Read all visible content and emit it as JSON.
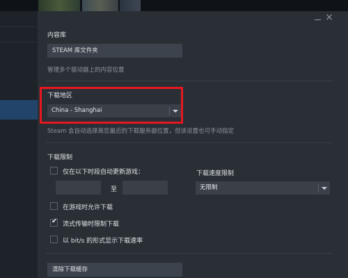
{
  "window": {
    "minimize_icon": "minimize-icon",
    "close_glyph": "×"
  },
  "library": {
    "heading": "内容库",
    "button_label": "STEAM 库文件夹",
    "description": "管理多个驱动器上的内容位置"
  },
  "download_region": {
    "heading": "下载地区",
    "selected": "China - Shanghai",
    "description": "Steam 会自动选择离您最近的下载服务器位置，但该设置也可手动指定",
    "highlight_color": "#e8171f"
  },
  "download_limits": {
    "heading": "下载限制",
    "schedule_label": "仅在以下时段自动更新游戏：",
    "between": "至",
    "speed_limit_label": "下载速度限制",
    "speed_limit_value": "无限制",
    "allow_during_gameplay": {
      "label": "在游戏时允许下载",
      "checked": false
    },
    "throttle_streaming": {
      "label": "流式传输时限制下载",
      "checked": true
    },
    "show_bits": {
      "label": "以 bit/s 的形式显示下载速率",
      "checked": false
    },
    "schedule_checked": false
  },
  "cache": {
    "button_label": "清除下载缓存"
  },
  "colors": {
    "dialog_bg": "#2a2f36",
    "control_bg": "#3a3f48",
    "text": "#dfe3e6",
    "muted": "#8b949c"
  }
}
